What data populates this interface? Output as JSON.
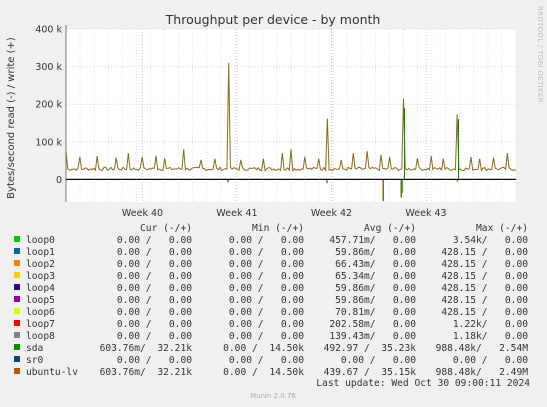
{
  "chart_data": {
    "type": "line",
    "title": "Throughput per device - by month",
    "ylabel": "Bytes/second read (-) / write (+)",
    "y_ticks": [
      "400 k",
      "300 k",
      "200 k",
      "100 k",
      "0"
    ],
    "ylim": [
      -60000,
      400000
    ],
    "x_ticks": [
      "Week 40",
      "Week 41",
      "Week 42",
      "Week 43"
    ],
    "grid": true,
    "side_label": "RRDTOOL / TOBI OETIKER",
    "baseline": 28000,
    "spikes_write": [
      {
        "x": 0.0,
        "value": 75000
      },
      {
        "x": 0.03,
        "value": 60000
      },
      {
        "x": 0.07,
        "value": 62000
      },
      {
        "x": 0.11,
        "value": 58000
      },
      {
        "x": 0.14,
        "value": 70000
      },
      {
        "x": 0.17,
        "value": 60000
      },
      {
        "x": 0.2,
        "value": 63000
      },
      {
        "x": 0.22,
        "value": 56000
      },
      {
        "x": 0.26,
        "value": 80000
      },
      {
        "x": 0.3,
        "value": 52000
      },
      {
        "x": 0.33,
        "value": 55000
      },
      {
        "x": 0.36,
        "value": 310000
      },
      {
        "x": 0.39,
        "value": 52000
      },
      {
        "x": 0.44,
        "value": 55000
      },
      {
        "x": 0.48,
        "value": 70000
      },
      {
        "x": 0.5,
        "value": 80000
      },
      {
        "x": 0.53,
        "value": 60000
      },
      {
        "x": 0.56,
        "value": 55000
      },
      {
        "x": 0.58,
        "value": 162000
      },
      {
        "x": 0.61,
        "value": 52000
      },
      {
        "x": 0.64,
        "value": 70000
      },
      {
        "x": 0.67,
        "value": 75000
      },
      {
        "x": 0.7,
        "value": 65000
      },
      {
        "x": 0.72,
        "value": 60000
      },
      {
        "x": 0.75,
        "value": 215000
      },
      {
        "x": 0.78,
        "value": 56000
      },
      {
        "x": 0.81,
        "value": 62000
      },
      {
        "x": 0.84,
        "value": 55000
      },
      {
        "x": 0.87,
        "value": 173000
      },
      {
        "x": 0.9,
        "value": 60000
      },
      {
        "x": 0.92,
        "value": 55000
      },
      {
        "x": 0.95,
        "value": 58000
      },
      {
        "x": 0.98,
        "value": 70000
      }
    ],
    "spikes_read": [
      {
        "x": 0.36,
        "value": -8000
      },
      {
        "x": 0.58,
        "value": -10000
      },
      {
        "x": 0.705,
        "value": -58000
      },
      {
        "x": 0.745,
        "value": -48000
      },
      {
        "x": 0.87,
        "value": -6000
      }
    ],
    "legend_header": {
      "cur": "Cur (-/+)",
      "min": "Min (-/+)",
      "avg": "Avg (-/+)",
      "max": "Max (-/+)"
    },
    "legend": [
      {
        "name": "loop0",
        "color": "#00cc00",
        "cur": "0.00 /   0.00",
        "min": "0.00 /   0.00",
        "avg": "457.71m/   0.00",
        "max": "3.54k/   0.00"
      },
      {
        "name": "loop1",
        "color": "#0066b3",
        "cur": "0.00 /   0.00",
        "min": "0.00 /   0.00",
        "avg": "59.86m/   0.00",
        "max": "428.15 /   0.00"
      },
      {
        "name": "loop2",
        "color": "#ff8000",
        "cur": "0.00 /   0.00",
        "min": "0.00 /   0.00",
        "avg": "66.43m/   0.00",
        "max": "428.15 /   0.00"
      },
      {
        "name": "loop3",
        "color": "#ffcc00",
        "cur": "0.00 /   0.00",
        "min": "0.00 /   0.00",
        "avg": "65.34m/   0.00",
        "max": "428.15 /   0.00"
      },
      {
        "name": "loop4",
        "color": "#330099",
        "cur": "0.00 /   0.00",
        "min": "0.00 /   0.00",
        "avg": "59.86m/   0.00",
        "max": "428.15 /   0.00"
      },
      {
        "name": "loop5",
        "color": "#990099",
        "cur": "0.00 /   0.00",
        "min": "0.00 /   0.00",
        "avg": "59.86m/   0.00",
        "max": "428.15 /   0.00"
      },
      {
        "name": "loop6",
        "color": "#ccff00",
        "cur": "0.00 /   0.00",
        "min": "0.00 /   0.00",
        "avg": "70.81m/   0.00",
        "max": "428.15 /   0.00"
      },
      {
        "name": "loop7",
        "color": "#ff0000",
        "cur": "0.00 /   0.00",
        "min": "0.00 /   0.00",
        "avg": "202.58m/   0.00",
        "max": "1.22k/   0.00"
      },
      {
        "name": "loop8",
        "color": "#808080",
        "cur": "0.00 /   0.00",
        "min": "0.00 /   0.00",
        "avg": "139.43m/   0.00",
        "max": "1.18k/   0.00"
      },
      {
        "name": "sda",
        "color": "#008f00",
        "cur": "603.76m/  32.21k",
        "min": "0.00 /  14.50k",
        "avg": "492.97 /  35.23k",
        "max": "988.48k/   2.54M"
      },
      {
        "name": "sr0",
        "color": "#00487d",
        "cur": "0.00 /   0.00",
        "min": "0.00 /   0.00",
        "avg": "0.00 /   0.00",
        "max": "0.00 /   0.00"
      },
      {
        "name": "ubuntu-lv",
        "color": "#b35a00",
        "cur": "603.76m/  32.21k",
        "min": "0.00 /  14.50k",
        "avg": "439.67 /  35.15k",
        "max": "988.48k/   2.49M"
      }
    ],
    "last_update": "Last update: Wed Oct 30 09:00:11 2024",
    "footer": "Munin 2.0.76"
  }
}
